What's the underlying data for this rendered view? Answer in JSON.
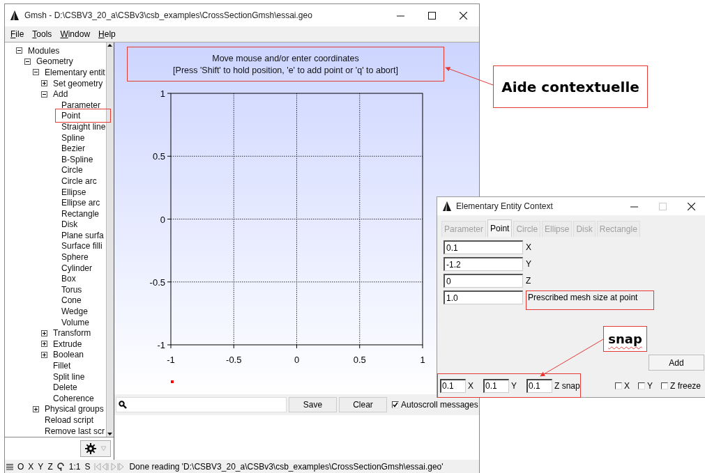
{
  "main_window": {
    "title": "Gmsh - D:\\CSBV3_20_a\\CSBv3\\csb_examples\\CrossSectionGmsh\\essai.geo",
    "menu": [
      "File",
      "Tools",
      "Window",
      "Help"
    ],
    "tree": [
      {
        "label": "Modules",
        "expanded": true,
        "children": [
          {
            "label": "Geometry",
            "expanded": true,
            "children": [
              {
                "label": "Elementary entit",
                "expanded": true,
                "children": [
                  {
                    "label": "Set geometry",
                    "expanded": false
                  },
                  {
                    "label": "Add",
                    "expanded": true,
                    "children": [
                      {
                        "label": "Parameter"
                      },
                      {
                        "label": "Point"
                      },
                      {
                        "label": "Straight line"
                      },
                      {
                        "label": "Spline"
                      },
                      {
                        "label": "Bezier"
                      },
                      {
                        "label": "B-Spline"
                      },
                      {
                        "label": "Circle"
                      },
                      {
                        "label": "Circle arc"
                      },
                      {
                        "label": "Ellipse"
                      },
                      {
                        "label": "Ellipse arc"
                      },
                      {
                        "label": "Rectangle"
                      },
                      {
                        "label": "Disk"
                      },
                      {
                        "label": "Plane surfa"
                      },
                      {
                        "label": "Surface filli"
                      },
                      {
                        "label": "Sphere"
                      },
                      {
                        "label": "Cylinder"
                      },
                      {
                        "label": "Box"
                      },
                      {
                        "label": "Torus"
                      },
                      {
                        "label": "Cone"
                      },
                      {
                        "label": "Wedge"
                      },
                      {
                        "label": "Volume"
                      }
                    ]
                  },
                  {
                    "label": "Transform",
                    "expanded": false
                  },
                  {
                    "label": "Extrude",
                    "expanded": false
                  },
                  {
                    "label": "Boolean",
                    "expanded": false
                  },
                  {
                    "label": "Fillet"
                  },
                  {
                    "label": "Split line"
                  },
                  {
                    "label": "Delete"
                  },
                  {
                    "label": "Coherence"
                  }
                ]
              },
              {
                "label": "Physical groups",
                "expanded": false
              },
              {
                "label": "Reload script"
              },
              {
                "label": "Remove last scr"
              }
            ]
          }
        ]
      }
    ],
    "canvas": {
      "message": [
        "Move mouse and/or enter coordinates",
        "[Press 'Shift' to hold position, 'e' to add point or 'q' to abort]"
      ],
      "axes": {
        "yticks": [
          "1",
          "0.5",
          "0",
          "-0.5",
          "-1"
        ],
        "xticks": [
          "-1",
          "-0.5",
          "0",
          "0.5",
          "1"
        ]
      }
    },
    "messages_toolbar": {
      "buttons": [
        "Save",
        "Clear"
      ],
      "autoscroll": {
        "label": "Autoscroll messages",
        "checked": true
      }
    },
    "status_bar": {
      "view_buttons": [
        "O",
        "X",
        "Y",
        "Z"
      ],
      "scale": "1:1",
      "s_button": "S",
      "message": "Done reading 'D:\\CSBV3_20_a\\CSBv3\\csb_examples\\CrossSectionGmsh\\essai.geo'"
    }
  },
  "context_window": {
    "title": "Elementary Entity Context",
    "tabs": [
      {
        "label": "Parameter",
        "selected": false,
        "disabled": true
      },
      {
        "label": "Point",
        "selected": true,
        "disabled": false
      },
      {
        "label": "Circle",
        "selected": false,
        "disabled": true
      },
      {
        "label": "Ellipse",
        "selected": false,
        "disabled": true
      },
      {
        "label": "Disk",
        "selected": false,
        "disabled": true
      },
      {
        "label": "Rectangle",
        "selected": false,
        "disabled": true
      }
    ],
    "fields": [
      {
        "value": "0.1",
        "label": "X"
      },
      {
        "value": "-1.2",
        "label": "Y"
      },
      {
        "value": "0",
        "label": "Z"
      },
      {
        "value": "1.0",
        "label": "Prescribed mesh size at point"
      }
    ],
    "add_button": "Add",
    "snap_row": [
      {
        "kind": "field",
        "text": "0.1"
      },
      {
        "kind": "label",
        "text": "X"
      },
      {
        "kind": "field",
        "text": "0.1"
      },
      {
        "kind": "label",
        "text": "Y"
      },
      {
        "kind": "field",
        "text": "0.1"
      },
      {
        "kind": "label",
        "text": "Z snap"
      }
    ],
    "freeze": [
      {
        "label": "X",
        "checked": false
      },
      {
        "label": "Y",
        "checked": false
      },
      {
        "label": "Z freeze",
        "checked": false
      }
    ]
  },
  "annotations": [
    {
      "text": "Aide contextuelle"
    },
    {
      "text": "snap"
    }
  ]
}
